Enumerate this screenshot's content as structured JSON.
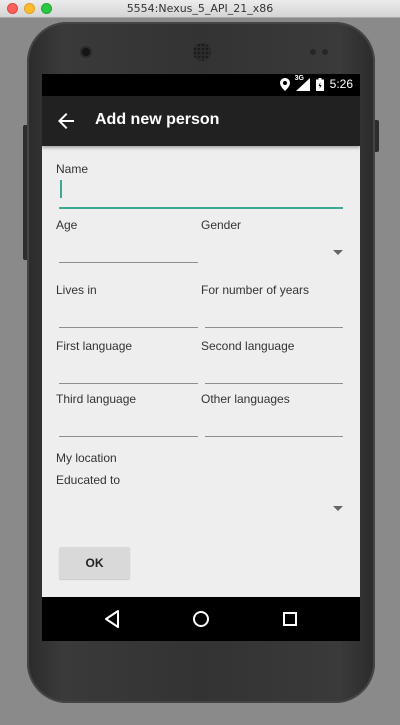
{
  "window": {
    "title": "5554:Nexus_5_API_21_x86"
  },
  "status_bar": {
    "signal_label": "3G",
    "time": "5:26"
  },
  "app_bar": {
    "title": "Add new person"
  },
  "form": {
    "name_label": "Name",
    "age_label": "Age",
    "gender_label": "Gender",
    "lives_in_label": "Lives in",
    "years_label": "For number of years",
    "first_language_label": "First language",
    "second_language_label": "Second language",
    "third_language_label": "Third language",
    "other_languages_label": "Other languages",
    "my_location_label": "My location",
    "educated_to_label": "Educated to",
    "ok_label": "OK"
  },
  "colors": {
    "accent": "#3aa894",
    "app_bar": "#212121",
    "background": "#eeeeee"
  },
  "icons": [
    "back-arrow-icon",
    "location-icon",
    "signal-icon",
    "battery-icon",
    "nav-back-icon",
    "nav-home-icon",
    "nav-recents-icon"
  ]
}
